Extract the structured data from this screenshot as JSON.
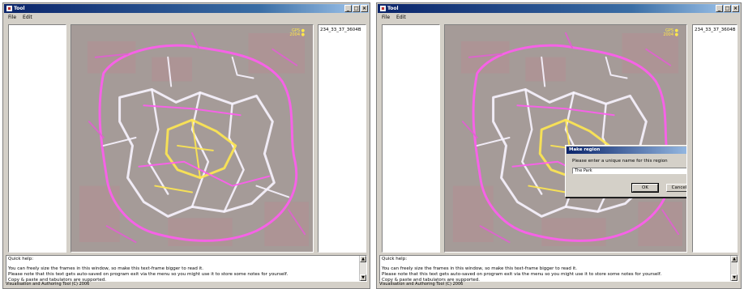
{
  "app": {
    "title": "Tool"
  },
  "menu": {
    "file": "File",
    "edit": "Edit"
  },
  "window_buttons": {
    "minimize": "_",
    "maximize": "□",
    "close": "×"
  },
  "track_list": {
    "selected_item": "234_33_37_3604B"
  },
  "map": {
    "corner_mark_line1": "GPS ●",
    "corner_mark_line2": "2004 ●",
    "track_colors": {
      "primary": "#ff5cf0",
      "secondary": "#f8f4ff",
      "highlight": "#ffe850",
      "accent": "#e060d0"
    }
  },
  "help": {
    "heading": "Quick help:",
    "lines": [
      "You can freely size the frames in this window, so make this text-frame bigger to read it.",
      "Please note that this text gets auto-saved on program exit via the menu so you might use it to store some notes for yourself.",
      "Copy & paste and tabulators are supported."
    ]
  },
  "status": {
    "text": "Visualisation and Authoring Tool (C) 2006"
  },
  "dialog": {
    "title": "Make region",
    "close_label": "×",
    "prompt": "Please enter a unique name for this region",
    "input_value": "The Park",
    "ok_label": "OK",
    "cancel_label": "Cancel"
  }
}
